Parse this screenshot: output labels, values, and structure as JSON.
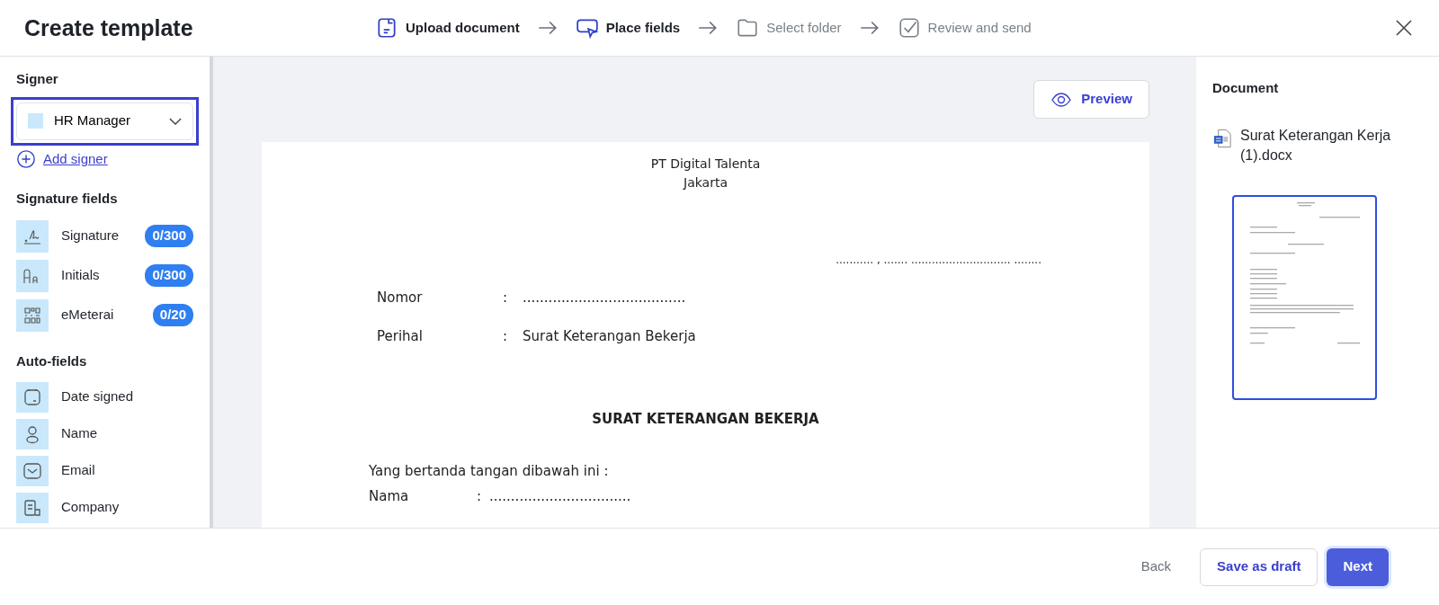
{
  "header": {
    "title": "Create template"
  },
  "steps": [
    {
      "label": "Upload document",
      "active": true
    },
    {
      "label": "Place fields",
      "active": true
    },
    {
      "label": "Select folder",
      "active": false
    },
    {
      "label": "Review and send",
      "active": false
    }
  ],
  "sidebar": {
    "signer_heading": "Signer",
    "signer": {
      "name": "HR Manager",
      "color": "#c9e8fb"
    },
    "add_signer": "Add signer",
    "signature_heading": "Signature fields",
    "signature_fields": [
      {
        "label": "Signature",
        "count": "0/300"
      },
      {
        "label": "Initials",
        "count": "0/300"
      },
      {
        "label": "eMeterai",
        "count": "0/20"
      }
    ],
    "auto_heading": "Auto-fields",
    "auto_fields": [
      {
        "label": "Date signed"
      },
      {
        "label": "Name"
      },
      {
        "label": "Email"
      },
      {
        "label": "Company"
      }
    ]
  },
  "preview_button": "Preview",
  "document": {
    "header_lines": [
      "PT Digital Talenta",
      "Jakarta"
    ],
    "date_line": "........... , ....... ............................. ........",
    "fields": [
      {
        "label": "Nomor",
        "colon": ":",
        "value": "......................................"
      },
      {
        "label": "Perihal",
        "colon": ":",
        "value": "Surat Keterangan Bekerja"
      }
    ],
    "title": "SURAT KETERANGAN BEKERJA",
    "intro": "Yang bertanda tangan dibawah ini :",
    "rows": [
      {
        "label": "Nama",
        "colon": ":",
        "value": "................................."
      }
    ]
  },
  "right_panel": {
    "heading": "Document",
    "file_name": "Surat Keterangan Kerja (1).docx"
  },
  "footer": {
    "back": "Back",
    "save_draft": "Save as draft",
    "next": "Next"
  }
}
